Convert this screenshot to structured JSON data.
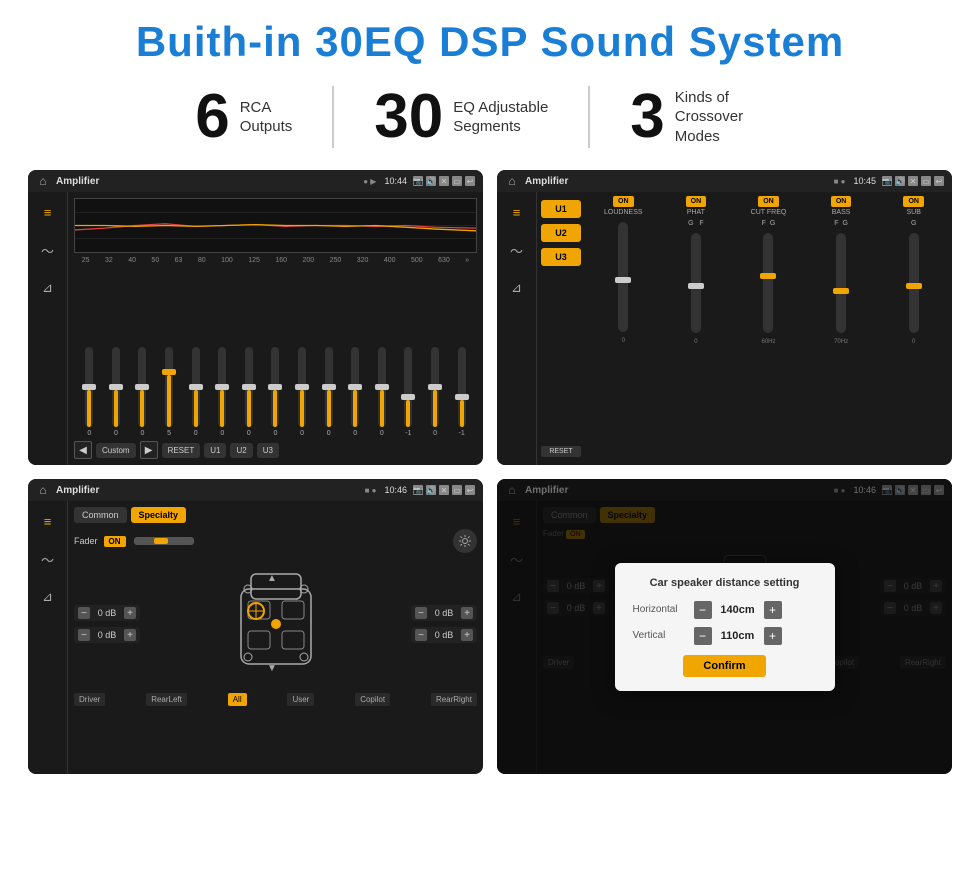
{
  "page": {
    "title": "Buith-in 30EQ DSP Sound System"
  },
  "stats": [
    {
      "number": "6",
      "label": "RCA\nOutputs"
    },
    {
      "number": "30",
      "label": "EQ Adjustable\nSegments"
    },
    {
      "number": "3",
      "label": "Kinds of\nCrossover Modes"
    }
  ],
  "screens": [
    {
      "id": "screen1",
      "label": "EQ Screen",
      "statusBar": {
        "app": "Amplifier",
        "time": "10:44"
      },
      "eqFreqs": [
        "25",
        "32",
        "40",
        "50",
        "63",
        "80",
        "100",
        "125",
        "160",
        "200",
        "250",
        "320",
        "400",
        "500",
        "630"
      ],
      "eqValues": [
        "0",
        "0",
        "0",
        "5",
        "0",
        "0",
        "0",
        "0",
        "0",
        "0",
        "0",
        "0",
        "-1",
        "0",
        "-1"
      ],
      "eqSliderPositions": [
        50,
        50,
        50,
        35,
        50,
        50,
        50,
        50,
        50,
        50,
        50,
        50,
        65,
        50,
        65
      ],
      "bottomButtons": [
        "Custom",
        "RESET",
        "U1",
        "U2",
        "U3"
      ]
    },
    {
      "id": "screen2",
      "label": "Crossover Screen",
      "statusBar": {
        "app": "Amplifier",
        "time": "10:45"
      },
      "uButtons": [
        "U1",
        "U2",
        "U3"
      ],
      "paramCols": [
        {
          "on": true,
          "label": "LOUDNESS"
        },
        {
          "on": true,
          "label": "PHAT"
        },
        {
          "on": true,
          "label": "CUT FREQ"
        },
        {
          "on": true,
          "label": "BASS"
        },
        {
          "on": true,
          "label": "SUB"
        }
      ],
      "resetLabel": "RESET"
    },
    {
      "id": "screen3",
      "label": "Fader Screen",
      "statusBar": {
        "app": "Amplifier",
        "time": "10:46"
      },
      "tabs": [
        "Common",
        "Specialty"
      ],
      "activeTab": "Specialty",
      "faderLabel": "Fader",
      "faderOn": "ON",
      "dbValues": [
        "0 dB",
        "0 dB",
        "0 dB",
        "0 dB"
      ],
      "positionLabels": [
        "Driver",
        "RearLeft",
        "All",
        "User",
        "Copilot",
        "RearRight"
      ]
    },
    {
      "id": "screen4",
      "label": "Distance Setting Screen",
      "statusBar": {
        "app": "Amplifier",
        "time": "10:46"
      },
      "tabs": [
        "Common",
        "Specialty"
      ],
      "activeTab": "Specialty",
      "dialog": {
        "title": "Car speaker distance setting",
        "rows": [
          {
            "label": "Horizontal",
            "value": "140cm"
          },
          {
            "label": "Vertical",
            "value": "110cm"
          }
        ],
        "confirmLabel": "Confirm"
      },
      "positionLabels": [
        "Driver",
        "RearLeft",
        "All",
        "User",
        "Copilot",
        "RearRight"
      ]
    }
  ]
}
